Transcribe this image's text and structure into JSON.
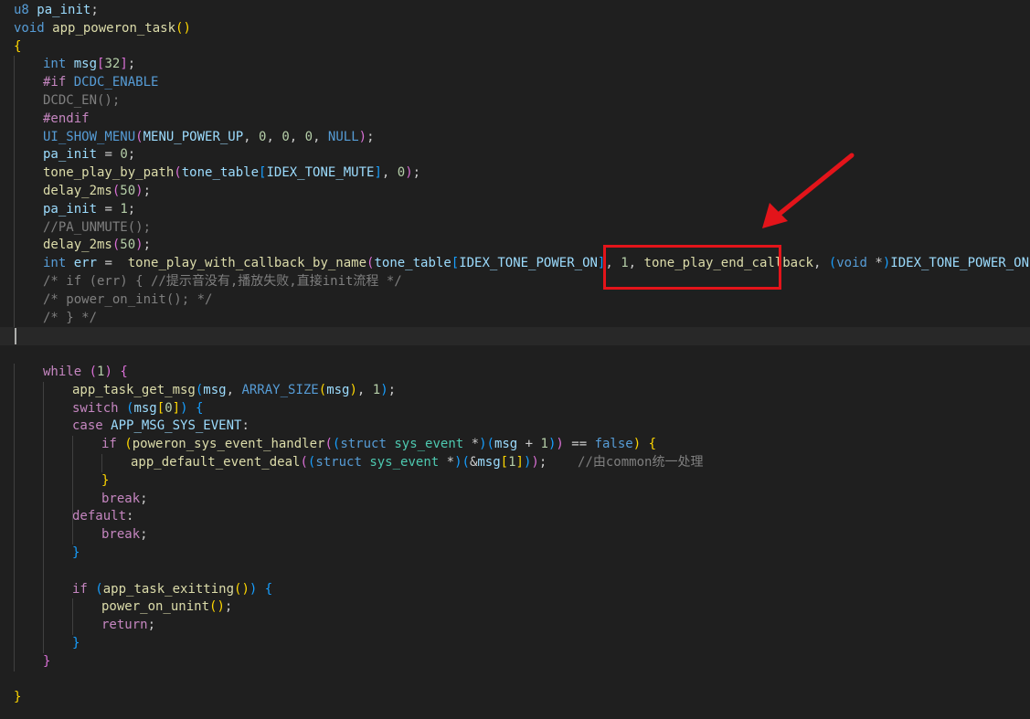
{
  "editor": {
    "lines": [
      {
        "indent": 0,
        "tokens": [
          [
            "u8 ",
            "kw"
          ],
          [
            "pa_init",
            "var"
          ],
          [
            ";",
            "pl"
          ]
        ]
      },
      {
        "indent": 0,
        "tokens": [
          [
            "void ",
            "kw"
          ],
          [
            "app_poweron_task",
            "fn"
          ],
          [
            "()",
            "b1"
          ]
        ]
      },
      {
        "indent": 0,
        "tokens": [
          [
            "{",
            "b1"
          ]
        ]
      },
      {
        "indent": 1,
        "tokens": [
          [
            "int ",
            "kw"
          ],
          [
            "msg",
            "var"
          ],
          [
            "[",
            "b2"
          ],
          [
            "32",
            "num"
          ],
          [
            "]",
            "b2"
          ],
          [
            ";",
            "pl"
          ]
        ]
      },
      {
        "indent": 1,
        "tokens": [
          [
            "#if ",
            "ctrl"
          ],
          [
            "DCDC_ENABLE",
            "mac"
          ]
        ]
      },
      {
        "indent": 1,
        "tokens": [
          [
            "DCDC_EN();",
            "dim"
          ]
        ]
      },
      {
        "indent": 1,
        "tokens": [
          [
            "#endif",
            "ctrl"
          ]
        ]
      },
      {
        "indent": 1,
        "tokens": [
          [
            "UI_SHOW_MENU",
            "mac"
          ],
          [
            "(",
            "b2"
          ],
          [
            "MENU_POWER_UP",
            "var"
          ],
          [
            ", ",
            "pl"
          ],
          [
            "0",
            "num"
          ],
          [
            ", ",
            "pl"
          ],
          [
            "0",
            "num"
          ],
          [
            ", ",
            "pl"
          ],
          [
            "0",
            "num"
          ],
          [
            ", ",
            "pl"
          ],
          [
            "NULL",
            "mac"
          ],
          [
            ")",
            "b2"
          ],
          [
            ";",
            "pl"
          ]
        ]
      },
      {
        "indent": 1,
        "tokens": [
          [
            "pa_init",
            "var"
          ],
          [
            " = ",
            "pl"
          ],
          [
            "0",
            "num"
          ],
          [
            ";",
            "pl"
          ]
        ]
      },
      {
        "indent": 1,
        "tokens": [
          [
            "tone_play_by_path",
            "fn"
          ],
          [
            "(",
            "b2"
          ],
          [
            "tone_table",
            "var"
          ],
          [
            "[",
            "b3"
          ],
          [
            "IDEX_TONE_MUTE",
            "var"
          ],
          [
            "]",
            "b3"
          ],
          [
            ", ",
            "pl"
          ],
          [
            "0",
            "num"
          ],
          [
            ")",
            "b2"
          ],
          [
            ";",
            "pl"
          ]
        ]
      },
      {
        "indent": 1,
        "tokens": [
          [
            "delay_2ms",
            "fn"
          ],
          [
            "(",
            "b2"
          ],
          [
            "50",
            "num"
          ],
          [
            ")",
            "b2"
          ],
          [
            ";",
            "pl"
          ]
        ]
      },
      {
        "indent": 1,
        "tokens": [
          [
            "pa_init",
            "var"
          ],
          [
            " = ",
            "pl"
          ],
          [
            "1",
            "num"
          ],
          [
            ";",
            "pl"
          ]
        ]
      },
      {
        "indent": 1,
        "tokens": [
          [
            "//PA_UNMUTE();",
            "dim"
          ]
        ]
      },
      {
        "indent": 1,
        "tokens": [
          [
            "delay_2ms",
            "fn"
          ],
          [
            "(",
            "b2"
          ],
          [
            "50",
            "num"
          ],
          [
            ")",
            "b2"
          ],
          [
            ";",
            "pl"
          ]
        ]
      },
      {
        "indent": 1,
        "tokens": [
          [
            "int ",
            "kw"
          ],
          [
            "err",
            "var"
          ],
          [
            " =  ",
            "pl"
          ],
          [
            "tone_play_with_callback_by_name",
            "fn"
          ],
          [
            "(",
            "b2"
          ],
          [
            "tone_table",
            "var"
          ],
          [
            "[",
            "b3"
          ],
          [
            "IDEX_TONE_POWER_ON",
            "var"
          ],
          [
            "]",
            "b3"
          ],
          [
            ", ",
            "pl"
          ],
          [
            "1",
            "num"
          ],
          [
            ", ",
            "pl"
          ],
          [
            "tone_play_end_callback",
            "fn"
          ],
          [
            ", ",
            "pl"
          ],
          [
            "(",
            "b3"
          ],
          [
            "void ",
            "kw"
          ],
          [
            "*",
            "pl"
          ],
          [
            ")",
            "b3"
          ],
          [
            "IDEX_TONE_POWER_ON",
            "var"
          ],
          [
            ")",
            "b2"
          ],
          [
            ";",
            "pl"
          ]
        ]
      },
      {
        "indent": 1,
        "tokens": [
          [
            "/* if (err) { //提示音没有,播放失败,直接init流程 */",
            "dim"
          ]
        ]
      },
      {
        "indent": 1,
        "tokens": [
          [
            "/* power_on_init(); */",
            "dim"
          ]
        ]
      },
      {
        "indent": 1,
        "tokens": [
          [
            "/* } */",
            "dim"
          ]
        ]
      },
      {
        "indent": 0,
        "tokens": [],
        "current": true
      },
      {
        "indent": 0,
        "tokens": []
      },
      {
        "indent": 1,
        "tokens": [
          [
            "while ",
            "ctrl"
          ],
          [
            "(",
            "b2"
          ],
          [
            "1",
            "num"
          ],
          [
            ")",
            "b2"
          ],
          [
            " ",
            "pl"
          ],
          [
            "{",
            "b2"
          ]
        ]
      },
      {
        "indent": 2,
        "tokens": [
          [
            "app_task_get_msg",
            "fn"
          ],
          [
            "(",
            "b3"
          ],
          [
            "msg",
            "var"
          ],
          [
            ", ",
            "pl"
          ],
          [
            "ARRAY_SIZE",
            "mac"
          ],
          [
            "(",
            "b1"
          ],
          [
            "msg",
            "var"
          ],
          [
            ")",
            "b1"
          ],
          [
            ", ",
            "pl"
          ],
          [
            "1",
            "num"
          ],
          [
            ")",
            "b3"
          ],
          [
            ";",
            "pl"
          ]
        ]
      },
      {
        "indent": 2,
        "tokens": [
          [
            "switch ",
            "ctrl"
          ],
          [
            "(",
            "b3"
          ],
          [
            "msg",
            "var"
          ],
          [
            "[",
            "b1"
          ],
          [
            "0",
            "num"
          ],
          [
            "]",
            "b1"
          ],
          [
            ")",
            "b3"
          ],
          [
            " ",
            "pl"
          ],
          [
            "{",
            "b3"
          ]
        ]
      },
      {
        "indent": 2,
        "tokens": [
          [
            "case ",
            "ctrl"
          ],
          [
            "APP_MSG_SYS_EVENT",
            "var"
          ],
          [
            ":",
            "pl"
          ]
        ]
      },
      {
        "indent": 3,
        "tokens": [
          [
            "if ",
            "ctrl"
          ],
          [
            "(",
            "b1"
          ],
          [
            "poweron_sys_event_handler",
            "fn"
          ],
          [
            "(",
            "b2"
          ],
          [
            "(",
            "b3"
          ],
          [
            "struct ",
            "kw"
          ],
          [
            "sys_event ",
            "ty"
          ],
          [
            "*",
            "pl"
          ],
          [
            ")",
            "b3"
          ],
          [
            "(",
            "b3"
          ],
          [
            "msg",
            "var"
          ],
          [
            " + ",
            "pl"
          ],
          [
            "1",
            "num"
          ],
          [
            ")",
            "b3"
          ],
          [
            ")",
            "b2"
          ],
          [
            " == ",
            "pl"
          ],
          [
            "false",
            "kw"
          ],
          [
            ")",
            "b1"
          ],
          [
            " ",
            "pl"
          ],
          [
            "{",
            "b1"
          ]
        ]
      },
      {
        "indent": 4,
        "tokens": [
          [
            "app_default_event_deal",
            "fn"
          ],
          [
            "(",
            "b2"
          ],
          [
            "(",
            "b3"
          ],
          [
            "struct ",
            "kw"
          ],
          [
            "sys_event ",
            "ty"
          ],
          [
            "*",
            "pl"
          ],
          [
            ")",
            "b3"
          ],
          [
            "(",
            "b3"
          ],
          [
            "&",
            "pl"
          ],
          [
            "msg",
            "var"
          ],
          [
            "[",
            "b1"
          ],
          [
            "1",
            "num"
          ],
          [
            "]",
            "b1"
          ],
          [
            ")",
            "b3"
          ],
          [
            ")",
            "b2"
          ],
          [
            ";",
            "pl"
          ],
          [
            "    ",
            "pl"
          ],
          [
            "//由common统一处理",
            "dim"
          ]
        ]
      },
      {
        "indent": 3,
        "tokens": [
          [
            "}",
            "b1"
          ]
        ]
      },
      {
        "indent": 3,
        "tokens": [
          [
            "break",
            "ctrl"
          ],
          [
            ";",
            "pl"
          ]
        ]
      },
      {
        "indent": 2,
        "tokens": [
          [
            "default",
            "ctrl"
          ],
          [
            ":",
            "pl"
          ]
        ]
      },
      {
        "indent": 3,
        "tokens": [
          [
            "break",
            "ctrl"
          ],
          [
            ";",
            "pl"
          ]
        ]
      },
      {
        "indent": 2,
        "tokens": [
          [
            "}",
            "b3"
          ]
        ]
      },
      {
        "indent": 0,
        "tokens": []
      },
      {
        "indent": 2,
        "tokens": [
          [
            "if ",
            "ctrl"
          ],
          [
            "(",
            "b3"
          ],
          [
            "app_task_exitting",
            "fn"
          ],
          [
            "()",
            "b1"
          ],
          [
            ")",
            "b3"
          ],
          [
            " ",
            "pl"
          ],
          [
            "{",
            "b3"
          ]
        ]
      },
      {
        "indent": 3,
        "tokens": [
          [
            "power_on_unint",
            "fn"
          ],
          [
            "()",
            "b1"
          ],
          [
            ";",
            "pl"
          ]
        ]
      },
      {
        "indent": 3,
        "tokens": [
          [
            "return",
            "ctrl"
          ],
          [
            ";",
            "pl"
          ]
        ]
      },
      {
        "indent": 2,
        "tokens": [
          [
            "}",
            "b3"
          ]
        ]
      },
      {
        "indent": 1,
        "tokens": [
          [
            "}",
            "b2"
          ]
        ]
      },
      {
        "indent": 0,
        "tokens": []
      },
      {
        "indent": 0,
        "tokens": [
          [
            "}",
            "b1"
          ]
        ]
      }
    ],
    "guides": [
      [
        1,
        3,
        17
      ],
      [
        1,
        20,
        36
      ],
      [
        2,
        21,
        35
      ],
      [
        3,
        24,
        29
      ],
      [
        4,
        25,
        25
      ],
      [
        2,
        32,
        34
      ],
      [
        3,
        33,
        34
      ]
    ],
    "annotation": {
      "color": "#e3141a",
      "highlight_target": "tone_play_end_callback"
    }
  }
}
